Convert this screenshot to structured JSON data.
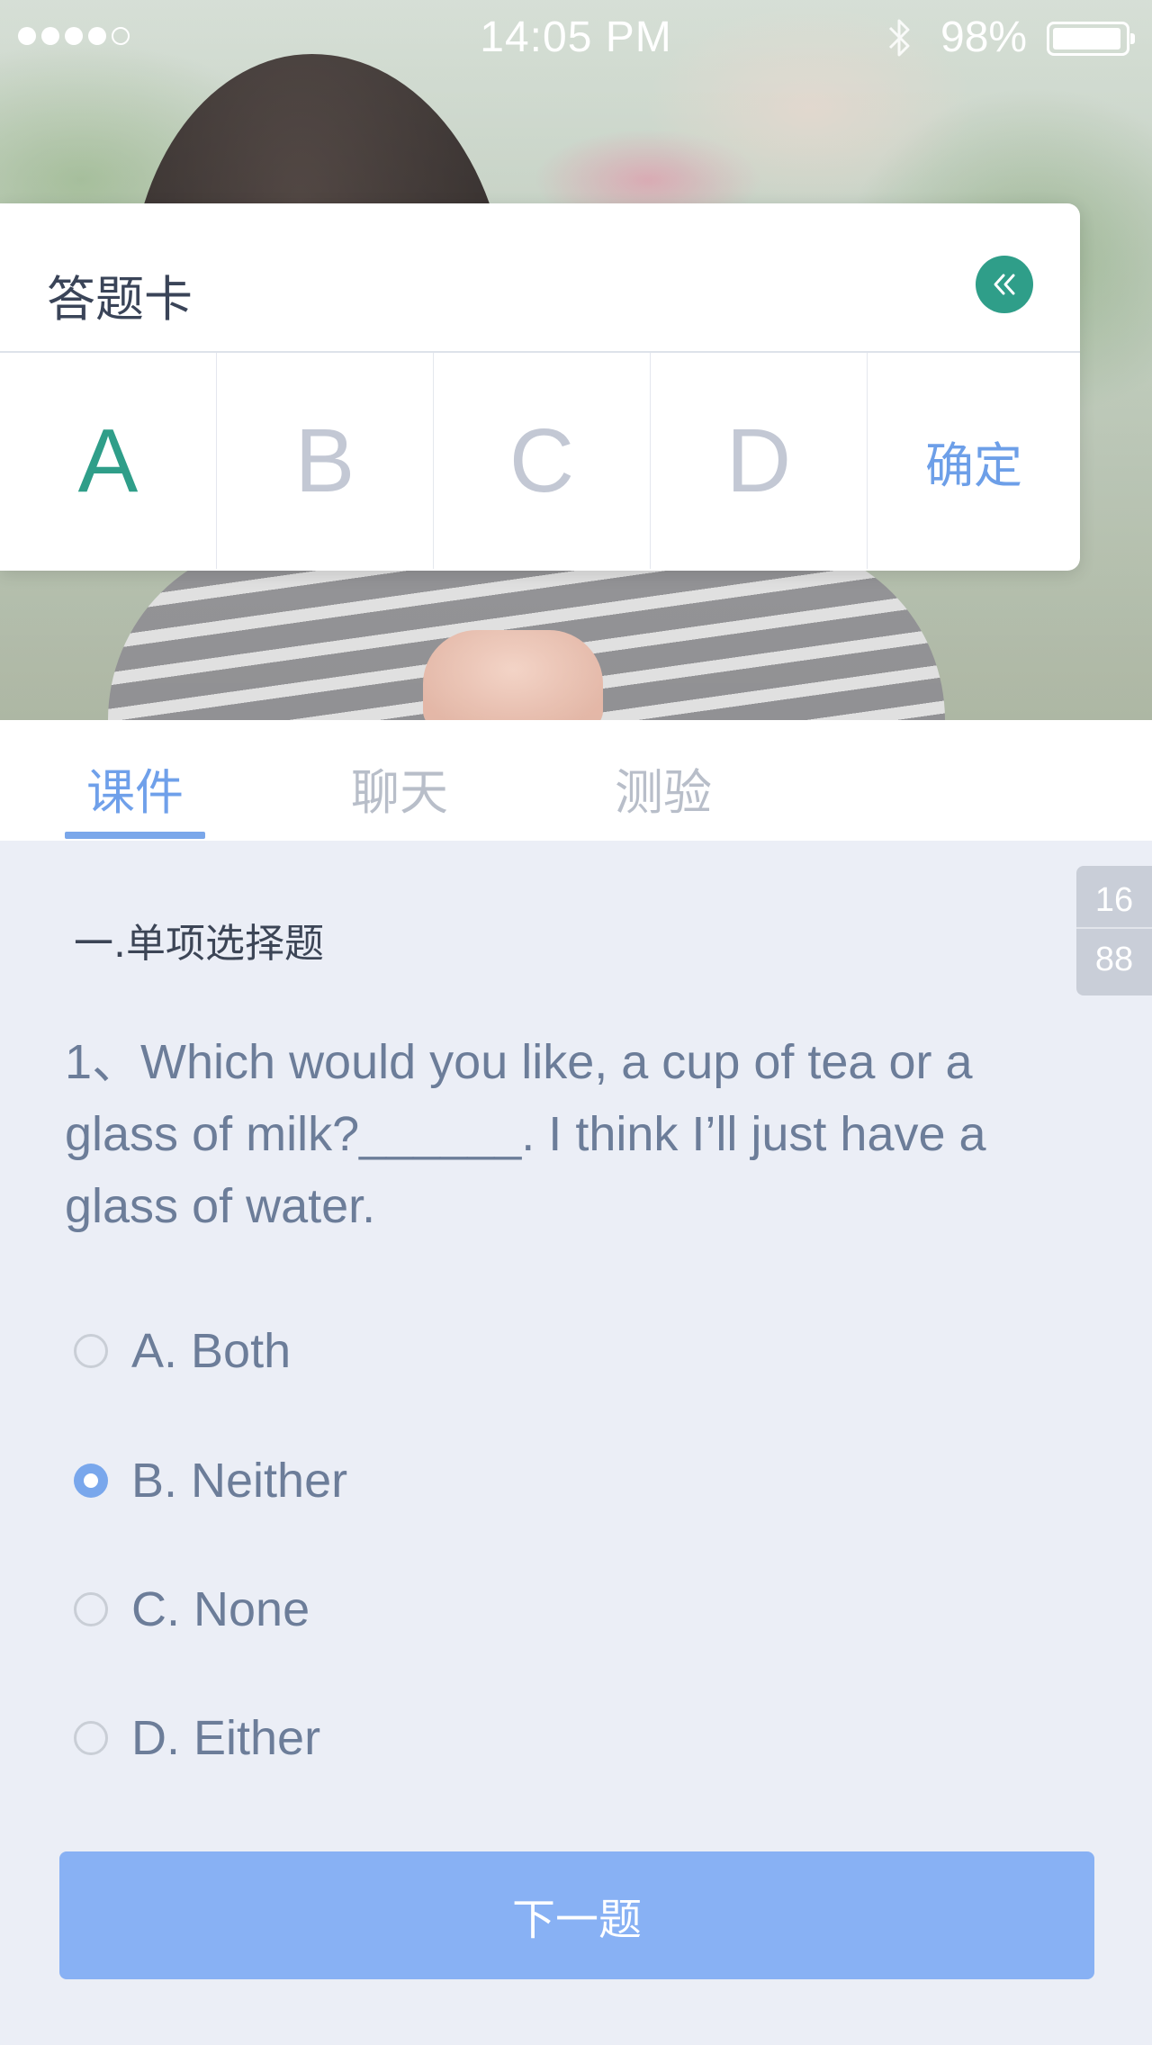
{
  "status_bar": {
    "time": "14:05 PM",
    "battery": "98%",
    "signal_bars_filled": 4,
    "signal_bars_total": 5,
    "battery_level": 0.98
  },
  "answer_card": {
    "title": "答题卡",
    "options": [
      "A",
      "B",
      "C",
      "D"
    ],
    "selected_option": "A",
    "confirm_label": "确定",
    "accent_color": "#2f9e89"
  },
  "tabs": [
    {
      "label": "课件",
      "active": true
    },
    {
      "label": "聊天",
      "active": false
    },
    {
      "label": "测验",
      "active": false
    }
  ],
  "page_counter": {
    "current": "16",
    "total": "88"
  },
  "section_title": "一.单项选择题",
  "question": {
    "text": "1、Which would you like, a cup of tea or a glass of milk?______. I think I’ll just have a glass of water.",
    "choices": [
      {
        "label": "A. Both",
        "selected": false
      },
      {
        "label": "B. Neither",
        "selected": true
      },
      {
        "label": "C. None",
        "selected": false
      },
      {
        "label": "D. Either",
        "selected": false
      }
    ]
  },
  "next_button": {
    "label": "下一题"
  },
  "colors": {
    "primary": "#88b1f4",
    "tab_active": "#6fa0ea",
    "background": "#ebeef6"
  }
}
